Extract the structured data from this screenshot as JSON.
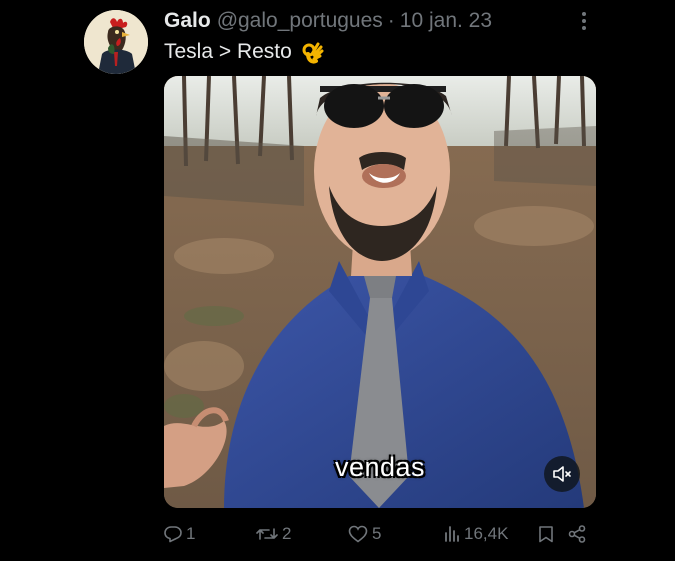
{
  "post": {
    "display_name": "Galo",
    "handle": "@galo_portugues",
    "separator": "·",
    "date": "10 jan. 23",
    "text": "Tesla > Resto",
    "emoji": "ok-hand-emoji",
    "more_icon": "more-options-icon"
  },
  "media": {
    "caption": "vendas",
    "mute_icon": "volume-muted-icon"
  },
  "actions": {
    "replies": "1",
    "reposts": "2",
    "likes": "5",
    "views": "16,4K",
    "icons": [
      "reply-icon",
      "repost-icon",
      "like-icon",
      "views-icon",
      "bookmark-icon",
      "share-icon"
    ]
  },
  "colors": {
    "background": "#000000",
    "text": "#e7e9ea",
    "secondary": "#71767b"
  }
}
